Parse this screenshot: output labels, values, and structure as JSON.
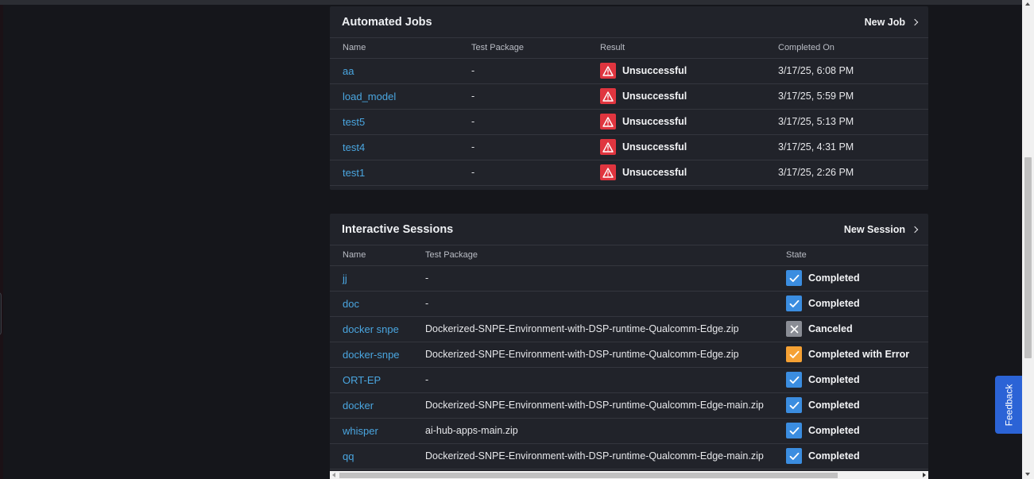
{
  "jobs": {
    "title": "Automated Jobs",
    "action_label": "New Job",
    "columns": [
      "Name",
      "Test Package",
      "Result",
      "Completed On"
    ],
    "rows": [
      {
        "name": "aa",
        "package": "-",
        "result": "Unsuccessful",
        "completed": "3/17/25, 6:08 PM"
      },
      {
        "name": "load_model",
        "package": "-",
        "result": "Unsuccessful",
        "completed": "3/17/25, 5:59 PM"
      },
      {
        "name": "test5",
        "package": "-",
        "result": "Unsuccessful",
        "completed": "3/17/25, 5:13 PM"
      },
      {
        "name": "test4",
        "package": "-",
        "result": "Unsuccessful",
        "completed": "3/17/25, 4:31 PM"
      },
      {
        "name": "test1",
        "package": "-",
        "result": "Unsuccessful",
        "completed": "3/17/25, 2:26 PM"
      }
    ]
  },
  "sessions": {
    "title": "Interactive Sessions",
    "action_label": "New Session",
    "columns": [
      "Name",
      "Test Package",
      "State"
    ],
    "rows": [
      {
        "name": "jj",
        "package": "-",
        "state": "Completed",
        "status": "ok"
      },
      {
        "name": "doc",
        "package": "-",
        "state": "Completed",
        "status": "ok"
      },
      {
        "name": "docker snpe",
        "package": "Dockerized-SNPE-Environment-with-DSP-runtime-Qualcomm-Edge.zip",
        "state": "Canceled",
        "status": "cancel"
      },
      {
        "name": "docker-snpe",
        "package": "Dockerized-SNPE-Environment-with-DSP-runtime-Qualcomm-Edge.zip",
        "state": "Completed with Error",
        "status": "err"
      },
      {
        "name": "ORT-EP",
        "package": "-",
        "state": "Completed",
        "status": "ok"
      },
      {
        "name": "docker",
        "package": "Dockerized-SNPE-Environment-with-DSP-runtime-Qualcomm-Edge-main.zip",
        "state": "Completed",
        "status": "ok"
      },
      {
        "name": "whisper",
        "package": "ai-hub-apps-main.zip",
        "state": "Completed",
        "status": "ok"
      },
      {
        "name": "qq",
        "package": "Dockerized-SNPE-Environment-with-DSP-runtime-Qualcomm-Edge-main.zip",
        "state": "Completed",
        "status": "ok"
      }
    ]
  },
  "feedback": {
    "label": "Feedback"
  },
  "colors": {
    "link": "#4aa6e0",
    "warn": "#e0353f",
    "ok": "#3b8de0",
    "cancel": "#8a8d95",
    "error": "#f5a134",
    "feedback": "#2b63d6"
  }
}
